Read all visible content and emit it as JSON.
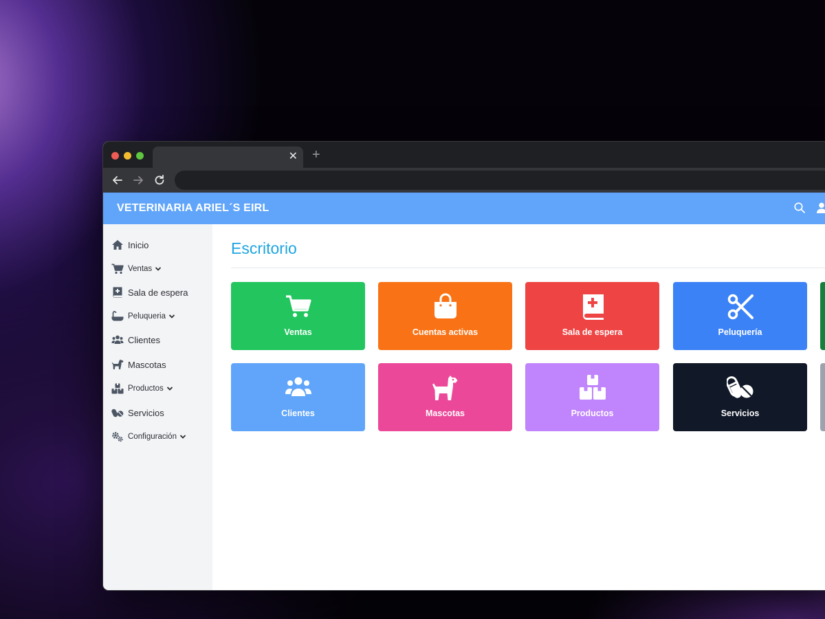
{
  "header": {
    "brand": "VETERINARIA ARIEL´S EIRL"
  },
  "sidebar": {
    "items": [
      {
        "label": "Inicio",
        "icon": "home-icon"
      },
      {
        "label": "Ventas",
        "icon": "cart-icon",
        "has_submenu": true
      },
      {
        "label": "Sala de espera",
        "icon": "medical-book-icon"
      },
      {
        "label": "Peluqueria",
        "icon": "bathtub-icon",
        "has_submenu": true
      },
      {
        "label": "Clientes",
        "icon": "users-icon"
      },
      {
        "label": "Mascotas",
        "icon": "dog-icon"
      },
      {
        "label": "Productos",
        "icon": "boxes-icon",
        "has_submenu": true
      },
      {
        "label": "Servicios",
        "icon": "pills-icon"
      },
      {
        "label": "Configuración",
        "icon": "gears-icon",
        "has_submenu": true
      }
    ]
  },
  "main": {
    "title": "Escritorio",
    "tiles": [
      {
        "label": "Ventas",
        "icon": "cart-icon",
        "color": "#22c55e"
      },
      {
        "label": "Cuentas activas",
        "icon": "shopping-bag-icon",
        "color": "#f97316"
      },
      {
        "label": "Sala de espera",
        "icon": "medical-book-icon",
        "color": "#ef4444"
      },
      {
        "label": "Peluquería",
        "icon": "scissors-icon",
        "color": "#3b82f6"
      },
      {
        "label": "Clientes",
        "icon": "users-icon",
        "color": "#60a5fa"
      },
      {
        "label": "Mascotas",
        "icon": "dog-icon",
        "color": "#ec4899"
      },
      {
        "label": "Productos",
        "icon": "boxes-icon",
        "color": "#c084fc"
      },
      {
        "label": "Servicios",
        "icon": "pills-icon",
        "color": "#111827"
      }
    ],
    "partial_tiles": [
      {
        "color": "#15803d"
      },
      {
        "color": "#9ca3af"
      }
    ]
  },
  "colors": {
    "header": "#60a5fa",
    "title": "#1ea5e0",
    "sidebar_bg": "#f3f4f6"
  }
}
